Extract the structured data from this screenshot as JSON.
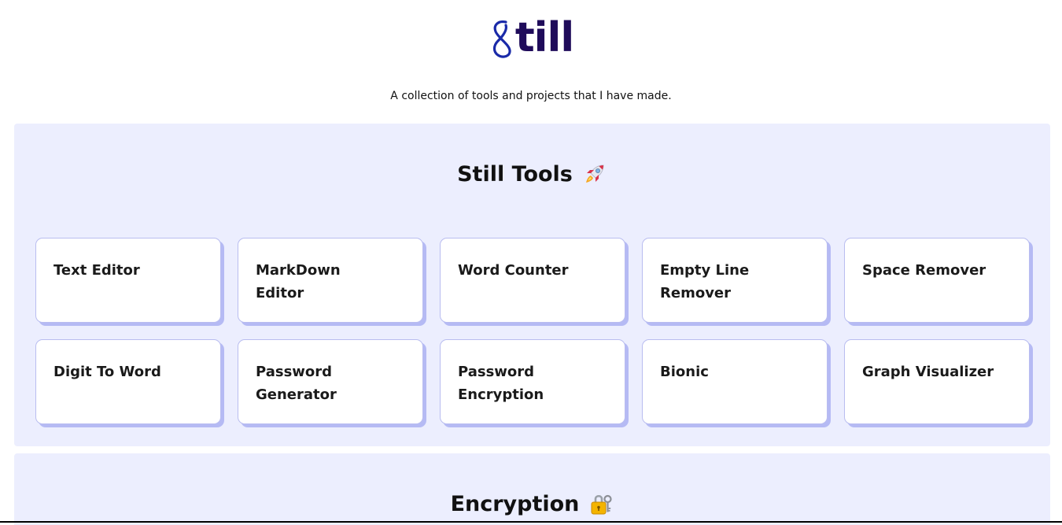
{
  "header": {
    "logo_text": "till",
    "tagline": "A collection of tools and projects that I have made."
  },
  "sections": {
    "tools": {
      "title": "Still Tools",
      "icon": "rocket-icon",
      "cards": [
        {
          "label": "Text Editor"
        },
        {
          "label": "MarkDown Editor"
        },
        {
          "label": "Word Counter"
        },
        {
          "label": "Empty Line Remover"
        },
        {
          "label": "Space Remover"
        },
        {
          "label": "Digit To Word"
        },
        {
          "label": "Password Generator"
        },
        {
          "label": "Password Encryption"
        },
        {
          "label": "Bionic"
        },
        {
          "label": "Graph Visualizer"
        }
      ]
    },
    "encryption": {
      "title": "Encryption",
      "icon": "locked-with-key-icon"
    }
  },
  "colors": {
    "logo": "#1f0b5a",
    "logo_mark": "#1a2aa8",
    "section_bg": "#eceefe",
    "card_shadow": "#b5baf4"
  }
}
